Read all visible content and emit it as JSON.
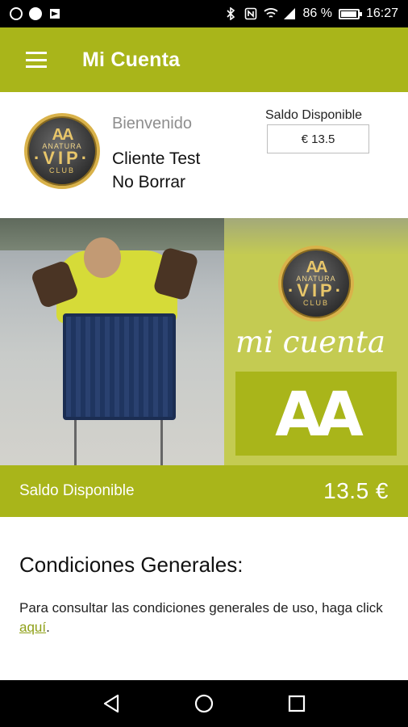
{
  "status_bar": {
    "battery": "86 %",
    "time": "16:27",
    "battery_level": 0.86
  },
  "app_bar": {
    "title": "Mi Cuenta",
    "menu_icon": "hamburger-menu-icon"
  },
  "header": {
    "welcome": "Bienvenido",
    "client_line1": "Cliente Test",
    "client_line2": "No Borrar",
    "balance_label": "Saldo Disponible",
    "balance_value": "€ 13.5",
    "badge": {
      "aa": "AA",
      "anatura": "ANATURA",
      "vip": "·VIP·",
      "club": "CLUB"
    }
  },
  "banner": {
    "script_text": "mi cuenta",
    "logo_text": "AA"
  },
  "balance_strip": {
    "label": "Saldo Disponible",
    "amount": "13.5 €"
  },
  "conditions": {
    "title": "Condiciones Generales:",
    "text_before": "Para consultar las condiciones generales de uso, haga click ",
    "link_text": "aquí",
    "text_after": "."
  },
  "colors": {
    "brand_green": "#a9b51a",
    "link_green": "#8fa018",
    "badge_gold": "#d9b24a"
  },
  "nav": {
    "back": "back-icon",
    "home": "home-icon",
    "recents": "recents-icon"
  }
}
